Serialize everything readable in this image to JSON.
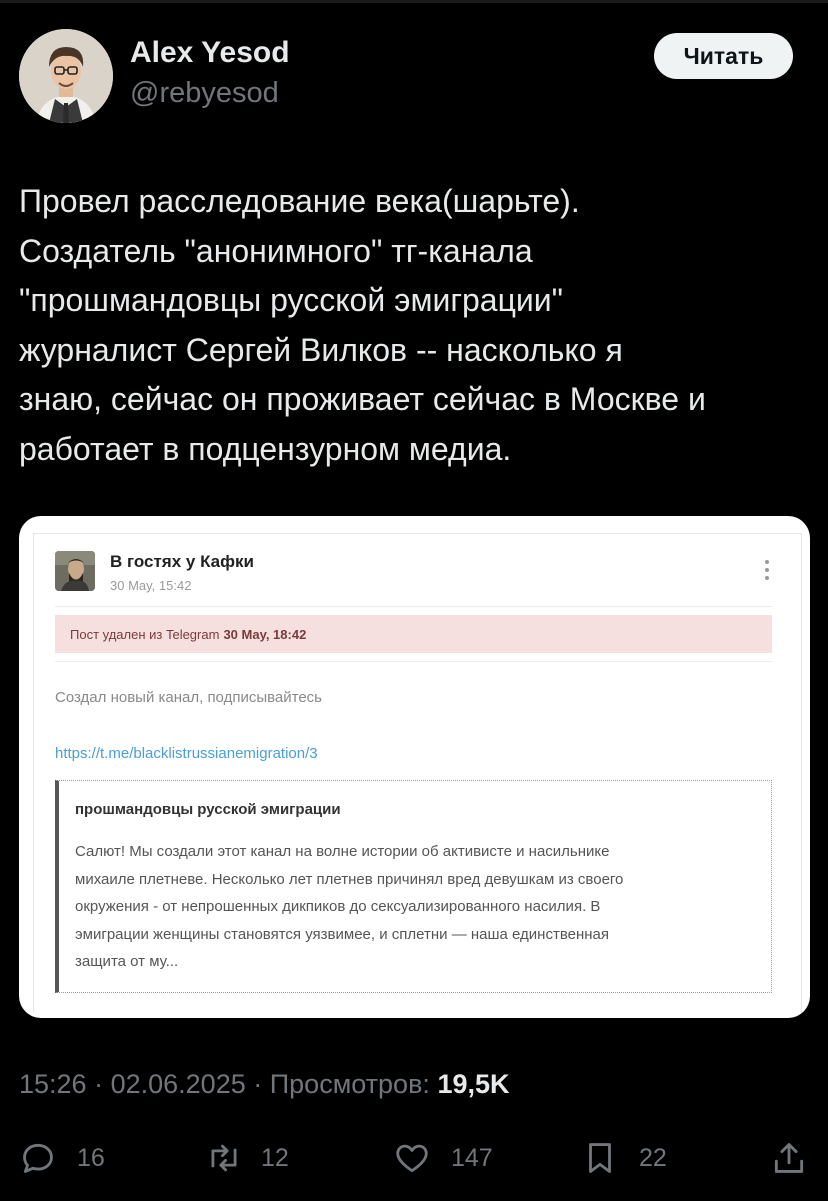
{
  "author": {
    "name": "Alex Yesod",
    "handle": "@rebyesod",
    "follow_label": "Читать"
  },
  "tweet": {
    "lines": [
      "Провел расследование века(шарьте).",
      "Создатель \"анонимного\" тг-канала",
      "\"прошмандовцы русской эмиграции\"",
      "журналист Сергей Вилков -- насколько я",
      "знаю, сейчас он проживает сейчас в Москве и",
      "работает в подцензурном медиа."
    ]
  },
  "card": {
    "channel_name": "В гостях у Кафки",
    "channel_date": "30 May, 15:42",
    "deleted_prefix": "Пост удален из Telegram",
    "deleted_date": "30 May, 18:42",
    "post_text": "Создал новый канал, подписывайтесь",
    "post_link": "https://t.me/blacklistrussianemigration/3",
    "quote_title": "прошмандовцы русской эмиграции",
    "quote_lines": [
      "Салют! Мы создали этот канал на волне истории об активисте и насильнике",
      "михаиле плетневе. Несколько лет плетнев причинял вред девушкам из своего",
      "окружения - от непрошенных дикпиков до сексуализированного насилия. В",
      "эмиграции женщины становятся уязвимее, и сплетни — наша единственная",
      "защита от му..."
    ]
  },
  "meta": {
    "time": "15:26",
    "date": "02.06.2025",
    "views_label": "Просмотров:",
    "views_count": "19,5K"
  },
  "actions": {
    "replies": "16",
    "retweets": "12",
    "likes": "147",
    "bookmarks": "22"
  },
  "icons": [
    "avatar-illustration",
    "channel-avatar",
    "more-dots-icon",
    "reply-icon",
    "retweet-icon",
    "like-icon",
    "bookmark-icon",
    "share-icon"
  ]
}
